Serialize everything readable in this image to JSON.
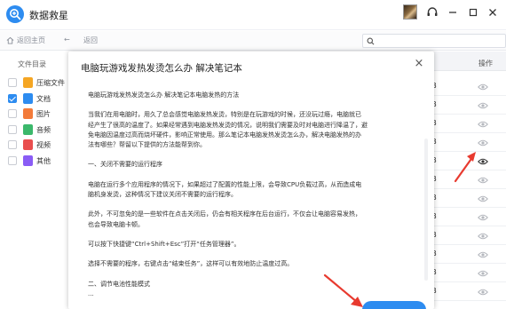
{
  "app": {
    "name": "数据救星"
  },
  "toolbar": {
    "back_home": "返回主页",
    "back": "返回"
  },
  "left": {
    "column_header": "文件目录",
    "categories": [
      {
        "label": "压缩文件",
        "checked": false,
        "color": "#f5a623"
      },
      {
        "label": "文档",
        "checked": true,
        "color": "#2d8cf0"
      },
      {
        "label": "图片",
        "checked": false,
        "color": "#f37b3a"
      },
      {
        "label": "音频",
        "checked": false,
        "color": "#3bb86b"
      },
      {
        "label": "视频",
        "checked": false,
        "color": "#e94e4e"
      },
      {
        "label": "其他",
        "checked": false,
        "color": "#8a5cf5"
      }
    ]
  },
  "table": {
    "op_header": "操作",
    "rows": [
      "KB",
      "KB",
      "KB",
      "KB",
      "KB",
      "KB",
      "KB",
      "KB",
      "KB",
      "KB",
      "KB",
      "KB"
    ]
  },
  "dialog": {
    "title": "电脑玩游戏发热发烫怎么办 解决笔记本",
    "lines": [
      "电脑玩游戏发热发烫怎么办 解决笔记本电脑发热的方法",
      "",
      "当我们在用电脑时，用久了总会感觉电脑发热发烫，特别是在玩游戏的时候，还没玩过瘾，电脑就已",
      "经产生了很高的温度了。如果经常遇到电脑发热发烫的情况，说明我们需要及时对电脑进行降温了，避",
      "免电脑因温度过高而烧坏硬件，影响正常使用。那么笔记本电脑发热发烫怎么办，解决电脑发热的办",
      "法有哪些？帮留以下提供的方法能帮到你。",
      "",
      "一、关闭不需要的运行程序",
      "",
      "电脑在运行多个应用程序的情况下，如果超过了配置的性能上限，会导致CPU负载过高，从而造成电",
      "脑机身发烫，这种情况下建议关闭不需要的运行程序。",
      "",
      "此外，不可忽免的是一些软件在点击关闭后，仍会有相关程序在后台运行，不仅会让电脑容易发热，",
      "也会导致电脑卡顿。",
      "",
      "可以按下快捷键“Ctrl+Shift+Esc”打开“任务管理器”。",
      "",
      "选择不需要的程序，右键点击“结束任务”，这样可以有效地防止温度过高。",
      "",
      "二、调节电池性能模式",
      "..."
    ],
    "close_symbol": "×"
  },
  "icons": {
    "logo": "plus-magnifier-icon",
    "support": "headset-icon",
    "minimize": "minimize-icon",
    "close": "close-icon",
    "home": "home-icon",
    "back": "back-arrow-icon",
    "search": "search-icon",
    "eye": "eye-icon"
  },
  "colors": {
    "accent": "#2d8cf0",
    "annotation_arrow": "#e83a2f"
  }
}
